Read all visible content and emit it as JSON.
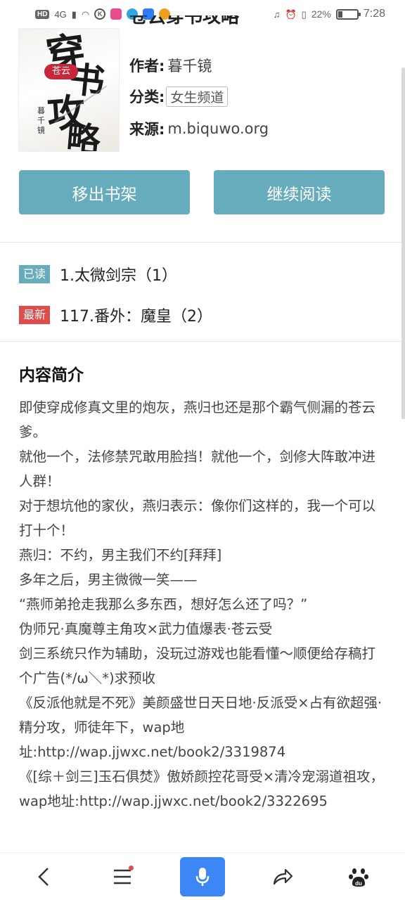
{
  "status_bar": {
    "network": "4G",
    "battery_percent_text": "22%",
    "battery_level": 0.22,
    "time": "7:28"
  },
  "book": {
    "title": "苍云穿书攻略",
    "cover": {
      "calligraphy": [
        "穿",
        "书",
        "攻",
        "略"
      ],
      "seal": "苍云",
      "author_vertical": "暮千镜"
    },
    "author_label": "作者:",
    "author": "暮千镜",
    "category_label": "分类:",
    "category": "女生频道",
    "source_label": "来源:",
    "source": "m.biquwo.org"
  },
  "actions": {
    "remove_label": "移出书架",
    "continue_label": "继续阅读"
  },
  "chapters": {
    "read_badge": "已读",
    "read_title": "1.太微剑宗（1）",
    "new_badge": "最新",
    "new_title": "117.番外：魔皇（2）"
  },
  "intro": {
    "heading": "内容简介",
    "lines": [
      "即使穿成修真文里的炮灰，燕归也还是那个霸气侧漏的苍云爹。",
      "就他一个，法修禁咒敢用脸挡！就他一个，剑修大阵敢冲进人群！",
      "对于想坑他的家伙，燕归表示：像你们这样的，我一个可以打十个！",
      "燕归：不约，男主我们不约[拜拜]",
      "多年之后，男主微微一笑——",
      "“燕师弟抢走我那么多东西，想好怎么还了吗？”",
      "伪师兄·真魔尊主角攻×武力值爆表·苍云受",
      "剑三系统只作为辅助，没玩过游戏也能看懂～顺便给存稿打个广告(*/ω＼*)求预收",
      "《反派他就是不死》美颜盛世日天日地·反派受×占有欲超强·精分攻，师徒年下，wap地址:http://wap.jjwxc.net/book2/3319874",
      "《[综＋剑三]玉石俱焚》傲娇颜控花哥受×清冷宠溺道祖攻，wap地址:http://wap.jjwxc.net/book2/3322695"
    ]
  },
  "bottom_nav": {
    "icons": [
      "back-icon",
      "menu-icon",
      "microphone-icon",
      "share-icon",
      "paw-icon"
    ],
    "accent": "#3d86f6"
  },
  "colors": {
    "button": "#67acbd",
    "badge_read": "#67acbd",
    "badge_new": "#e04b4b"
  }
}
